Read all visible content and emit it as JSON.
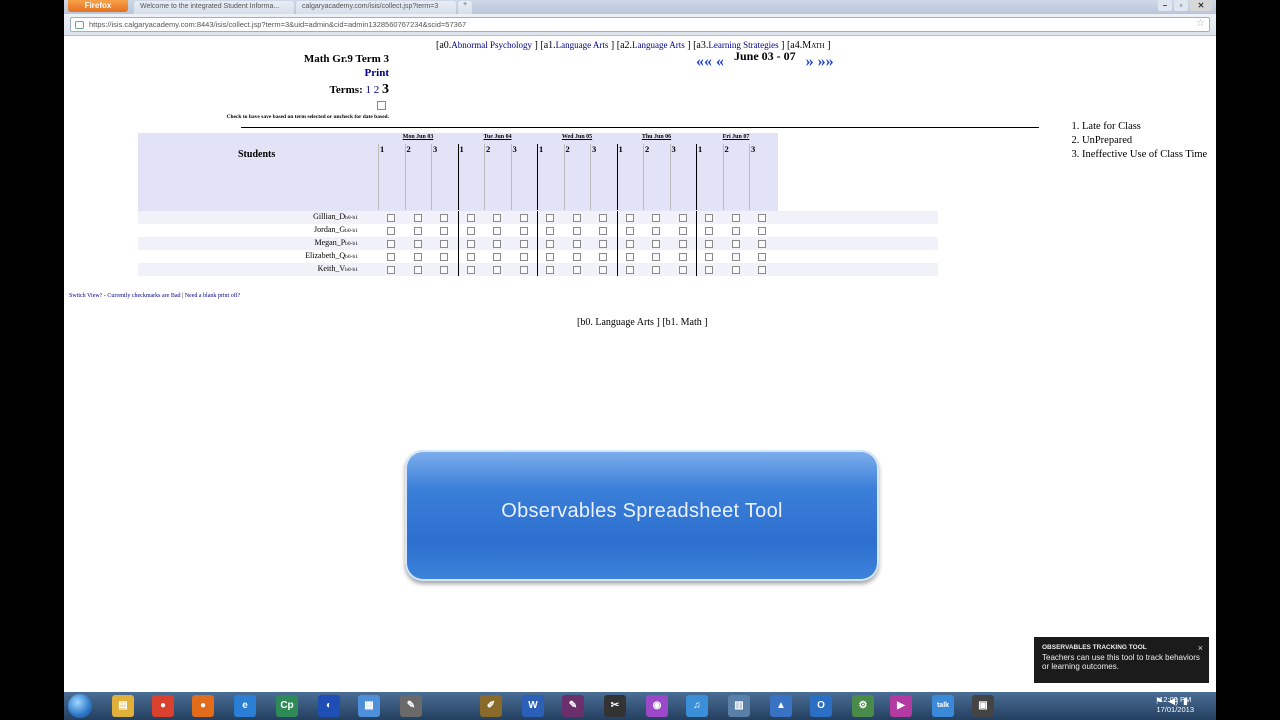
{
  "browser": {
    "app_button": "Firefox",
    "tabs": [
      "Welcome to the integrated Student Informa...",
      "calgaryacademy.com/isis/collect.jsp?term=3"
    ],
    "new_tab": "+",
    "url": "https://isis.calgaryacademy.com:8443/isis/collect.jsp?term=3&uid=admin&cid=admin1328560767234&scid=57367",
    "window_controls": {
      "minimize": "–",
      "maximize": "▫",
      "close": "✕"
    }
  },
  "course_nav": {
    "items": [
      {
        "code": "a0",
        "label": "Abnormal Psychology",
        "current": false
      },
      {
        "code": "a1",
        "label": "Language Arts",
        "current": false
      },
      {
        "code": "a2",
        "label": "Language Arts",
        "current": false
      },
      {
        "code": "a3",
        "label": "Learning Strategies",
        "current": false
      },
      {
        "code": "a4",
        "label": "Math",
        "current": true
      }
    ]
  },
  "class_info": {
    "title": "Math Gr.9 Term 3",
    "print": "Print",
    "terms_label": "Terms:",
    "terms": [
      "1",
      "2",
      "3"
    ],
    "current_term": "3",
    "checkbox_label": "Check to have save based on term selected or uncheck for date based."
  },
  "date_nav": {
    "prev_far": "«« ",
    "prev": "«",
    "range": "June 03 - 07",
    "next": "»",
    "next_far": "»»"
  },
  "legend": [
    "Late for Class",
    "UnPrepared",
    "Ineffective Use of Class Time"
  ],
  "grid": {
    "students_header": "Students",
    "days": [
      "Mon Jun 03",
      "Tue Jun 04",
      "Wed Jun 05",
      "Thu Jun 06",
      "Fri Jun 07"
    ],
    "periods": [
      "1",
      "2",
      "3"
    ],
    "students": [
      {
        "name": "Gillian_D",
        "tag": "b0-b1"
      },
      {
        "name": "Jordan_G",
        "tag": "b0-b1"
      },
      {
        "name": "Megan_P",
        "tag": "b0-b1"
      },
      {
        "name": "Elizabeth_Q",
        "tag": "b0-b1"
      },
      {
        "name": "Keith_V",
        "tag": "b0-b1"
      }
    ]
  },
  "footer_links": {
    "switch_view": "Switch View? - Currently checkmarks are Bad",
    "separator": "|",
    "blank_print": "Need a blank print off?"
  },
  "course_nav_b": {
    "items": [
      {
        "code": "b0",
        "label": "Language Arts"
      },
      {
        "code": "b1",
        "label": "Math"
      }
    ]
  },
  "overlay": {
    "title": "Observables Spreadsheet Tool"
  },
  "toast": {
    "title": "OBSERVABLES TRACKING TOOL",
    "body": "Teachers can use this tool to track behaviors or learning outcomes.",
    "close": "×"
  },
  "taskbar": {
    "apps": [
      {
        "icon": "explorer-icon",
        "glyph": "▤",
        "color": "#e0b03a"
      },
      {
        "icon": "chrome-icon",
        "glyph": "●",
        "color": "#d9412e"
      },
      {
        "icon": "firefox-icon",
        "glyph": "●",
        "color": "#e36b1c"
      },
      {
        "icon": "ie-icon",
        "glyph": "e",
        "color": "#2a7fd4"
      },
      {
        "icon": "captivate-icon",
        "glyph": "Cp",
        "color": "#2e8b57"
      },
      {
        "icon": "app-icon",
        "glyph": "◐",
        "color": "#1f4fb5"
      },
      {
        "icon": "notepad-icon",
        "glyph": "▦",
        "color": "#4d8fd8"
      },
      {
        "icon": "pen-icon",
        "glyph": "✎",
        "color": "#6a6a6a"
      },
      {
        "icon": "tools-icon",
        "glyph": "✐",
        "color": "#8a6a2a"
      },
      {
        "icon": "word-icon",
        "glyph": "W",
        "color": "#2b5fb8"
      },
      {
        "icon": "draw-icon",
        "glyph": "✎",
        "color": "#6b2f6b"
      },
      {
        "icon": "snip-icon",
        "glyph": "✂",
        "color": "#333"
      },
      {
        "icon": "picasa-icon",
        "glyph": "◉",
        "color": "#9b49c9"
      },
      {
        "icon": "itunes-icon",
        "glyph": "♫",
        "color": "#3a8fd8"
      },
      {
        "icon": "calculator-icon",
        "glyph": "▥",
        "color": "#5a7fa8"
      },
      {
        "icon": "paint-icon",
        "glyph": "▲",
        "color": "#3a72c4"
      },
      {
        "icon": "outlook-icon",
        "glyph": "O",
        "color": "#2a6fc4"
      },
      {
        "icon": "network-icon",
        "glyph": "⚙",
        "color": "#4a8a4a"
      },
      {
        "icon": "media-icon",
        "glyph": "▶",
        "color": "#b23aa0"
      },
      {
        "icon": "gtalk-icon",
        "glyph": "talk",
        "color": "#3a8ad8"
      },
      {
        "icon": "screen-capture-icon",
        "glyph": "▣",
        "color": "#444"
      }
    ],
    "clock_time": "12:09 PM",
    "clock_date": "17/01/2013"
  }
}
